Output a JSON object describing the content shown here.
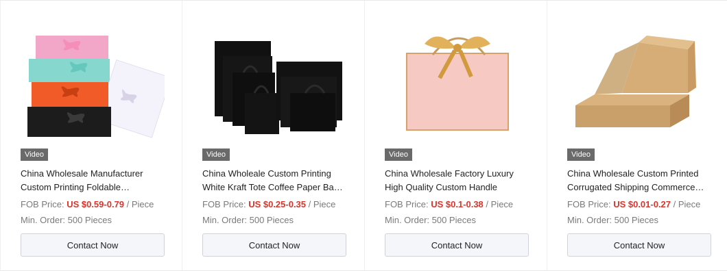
{
  "products": [
    {
      "badge": "Video",
      "title": "China Wholesale Manufacturer Custom Printing Foldable…",
      "price_label": "FOB Price: ",
      "price_value": "US $0.59-0.79",
      "price_unit": " / Piece",
      "moq": "Min. Order: 500 Pieces",
      "cta": "Contact Now",
      "image_icon": "gift-boxes-icon"
    },
    {
      "badge": "Video",
      "title": "China Wholeale Custom Printing White Kraft Tote Coffee Paper Ba…",
      "price_label": "FOB Price: ",
      "price_value": "US $0.25-0.35",
      "price_unit": " / Piece",
      "moq": "Min. Order: 500 Pieces",
      "cta": "Contact Now",
      "image_icon": "paper-bags-icon"
    },
    {
      "badge": "Video",
      "title": "China Wholesale Factory Luxury High Quality Custom Handle Pape…",
      "price_label": "FOB Price: ",
      "price_value": "US $0.1-0.38",
      "price_unit": " / Piece",
      "moq": "Min. Order: 500 Pieces",
      "cta": "Contact Now",
      "image_icon": "pink-gift-bag-icon"
    },
    {
      "badge": "Video",
      "title": "China Wholesale Custom Printed Corrugated Shipping Commerce…",
      "price_label": "FOB Price: ",
      "price_value": "US $0.01-0.27",
      "price_unit": " / Piece",
      "moq": "Min. Order: 500 Pieces",
      "cta": "Contact Now",
      "image_icon": "kraft-mailer-box-icon"
    }
  ],
  "colors": {
    "price": "#d9342b",
    "button_bg": "#f5f6fa",
    "button_border": "#cfd3d9"
  }
}
